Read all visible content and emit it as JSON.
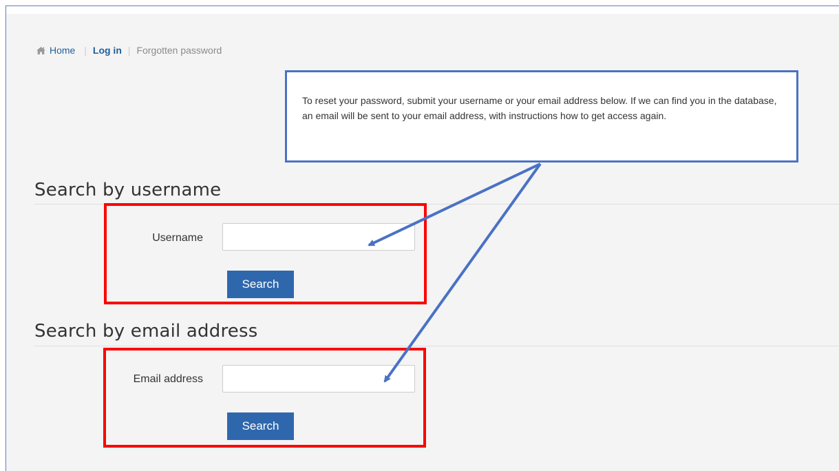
{
  "breadcrumb": {
    "home": "Home",
    "login": "Log in",
    "current": "Forgotten password"
  },
  "info_box": {
    "text": "To reset your password, submit your username or your email address below. If we can find you in the database, an email will be sent to your email address, with instructions how to get access again."
  },
  "username_section": {
    "heading": "Search by username",
    "label": "Username",
    "value": "",
    "button": "Search"
  },
  "email_section": {
    "heading": "Search by email address",
    "label": "Email address",
    "value": "",
    "button": "Search"
  },
  "colors": {
    "annotation_blue": "#4a72c4",
    "annotation_red": "#ff0000",
    "button_blue": "#2f67ad",
    "link_blue": "#1f5f9c"
  },
  "icons": {
    "home": "home-icon"
  }
}
